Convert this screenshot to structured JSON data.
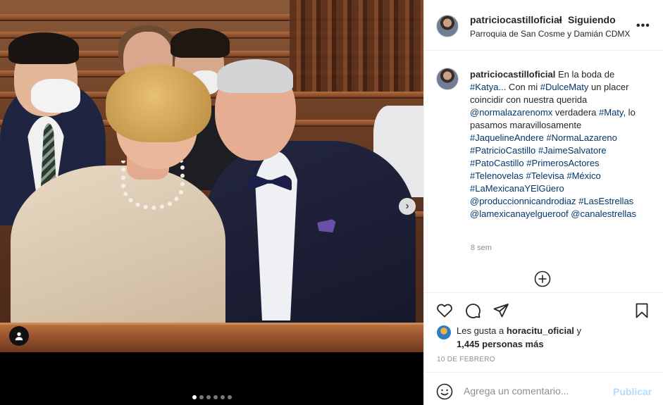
{
  "post": {
    "username": "patriciocastilloficial",
    "separator": "•",
    "follow_label": "Siguiendo",
    "location": "Parroquia de San Cosme y Damián CDMX",
    "more_label": "•••"
  },
  "caption": {
    "username": "patriciocastilloficial",
    "parts": [
      {
        "t": " En la boda de ",
        "tag": false
      },
      {
        "t": "#Katya",
        "tag": true
      },
      {
        "t": "... Con mi ",
        "tag": false
      },
      {
        "t": "#DulceMaty",
        "tag": true
      },
      {
        "t": " un placer coincidir con nuestra querida ",
        "tag": false
      },
      {
        "t": "@normalazarenomx",
        "tag": true
      },
      {
        "t": " verdadera ",
        "tag": false
      },
      {
        "t": "#Maty",
        "tag": true
      },
      {
        "t": ", lo pasamos maravillosamente ",
        "tag": false
      },
      {
        "t": "#JaquelineAndere",
        "tag": true
      },
      {
        "t": " ",
        "tag": false
      },
      {
        "t": "#NormaLazareno",
        "tag": true
      },
      {
        "t": " ",
        "tag": false
      },
      {
        "t": "#PatricioCastillo",
        "tag": true
      },
      {
        "t": " ",
        "tag": false
      },
      {
        "t": "#JaimeSalvatore",
        "tag": true
      },
      {
        "t": " ",
        "tag": false
      },
      {
        "t": "#PatoCastillo",
        "tag": true
      },
      {
        "t": " ",
        "tag": false
      },
      {
        "t": "#PrimerosActores",
        "tag": true
      },
      {
        "t": " ",
        "tag": false
      },
      {
        "t": "#Telenovelas",
        "tag": true
      },
      {
        "t": " ",
        "tag": false
      },
      {
        "t": "#Televisa",
        "tag": true
      },
      {
        "t": " ",
        "tag": false
      },
      {
        "t": "#México",
        "tag": true
      },
      {
        "t": " ",
        "tag": false
      },
      {
        "t": "#LaMexicanaYElGüero",
        "tag": true
      },
      {
        "t": " ",
        "tag": false
      },
      {
        "t": "@produccionnicandrodiaz",
        "tag": true
      },
      {
        "t": " ",
        "tag": false
      },
      {
        "t": "#LasEstrellas",
        "tag": true
      },
      {
        "t": " ",
        "tag": false
      },
      {
        "t": "@lamexicanayelgueroof",
        "tag": true
      },
      {
        "t": " ",
        "tag": false
      },
      {
        "t": "@canalestrellas",
        "tag": true
      }
    ],
    "time": "8 sem"
  },
  "likes": {
    "prefix": "Les gusta a ",
    "first_user": "horacitu_oficial",
    "conj": " y",
    "others": "1,445 personas más"
  },
  "date": "10 DE FEBRERO",
  "comment": {
    "placeholder": "Agrega un comentario...",
    "publish_label": "Publicar"
  },
  "carousel": {
    "total": 6,
    "active": 0
  },
  "icons": {
    "like": "heart-icon",
    "comment": "comment-icon",
    "share": "paper-plane-icon",
    "save": "bookmark-icon",
    "add": "add-circle-icon",
    "emoji": "smiley-icon",
    "tag": "user-tag-icon",
    "next": "chevron-right-icon"
  },
  "colors": {
    "link": "#00376b",
    "muted": "#8e8e8e",
    "publish_disabled": "#b3dbff"
  }
}
